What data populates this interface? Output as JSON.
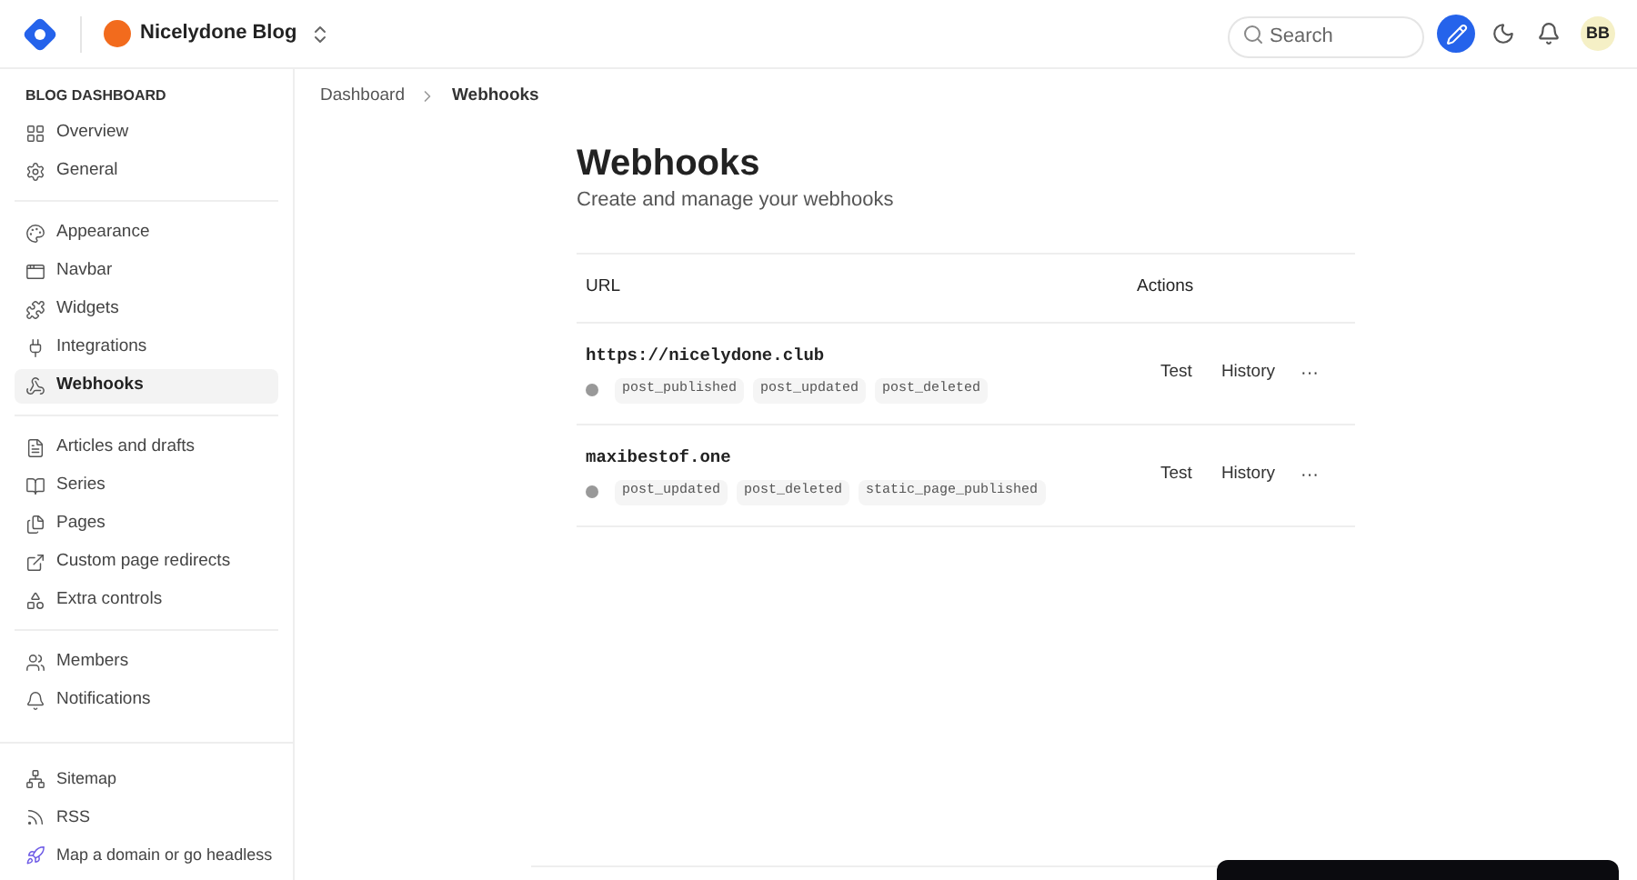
{
  "header": {
    "blog_name": "Nicelydone Blog",
    "search": {
      "placeholder": "Search"
    },
    "avatar": "BB"
  },
  "sidebar": {
    "heading": "BLOG DASHBOARD",
    "sections": [
      [
        {
          "label": "Overview",
          "selected": false
        },
        {
          "label": "General",
          "selected": false
        }
      ],
      [
        {
          "label": "Appearance",
          "selected": false
        },
        {
          "label": "Navbar",
          "selected": false
        },
        {
          "label": "Widgets",
          "selected": false
        },
        {
          "label": "Integrations",
          "selected": false
        },
        {
          "label": "Webhooks",
          "selected": true
        }
      ],
      [
        {
          "label": "Articles and drafts",
          "selected": false
        },
        {
          "label": "Series",
          "selected": false
        },
        {
          "label": "Pages",
          "selected": false
        },
        {
          "label": "Custom page redirects",
          "selected": false
        },
        {
          "label": "Extra controls",
          "selected": false
        }
      ],
      [
        {
          "label": "Members",
          "selected": false
        },
        {
          "label": "Notifications",
          "selected": false
        }
      ]
    ],
    "footer_items": [
      {
        "label": "Sitemap"
      },
      {
        "label": "RSS"
      },
      {
        "label": "Map a domain or go headless"
      }
    ]
  },
  "breadcrumb": [
    "Dashboard",
    "Webhooks"
  ],
  "page": {
    "title": "Webhooks",
    "subtitle": "Create and manage your webhooks"
  },
  "table": {
    "columns": [
      "URL",
      "Actions"
    ],
    "rows": [
      {
        "url": "https://nicelydone.club",
        "events": [
          "post_published",
          "post_updated",
          "post_deleted"
        ],
        "actions": [
          "Test",
          "History"
        ],
        "more": "···"
      },
      {
        "url": "maxibestof.one",
        "events": [
          "post_updated",
          "post_deleted",
          "static_page_published"
        ],
        "actions": [
          "Test",
          "History"
        ],
        "more": "···"
      }
    ]
  }
}
